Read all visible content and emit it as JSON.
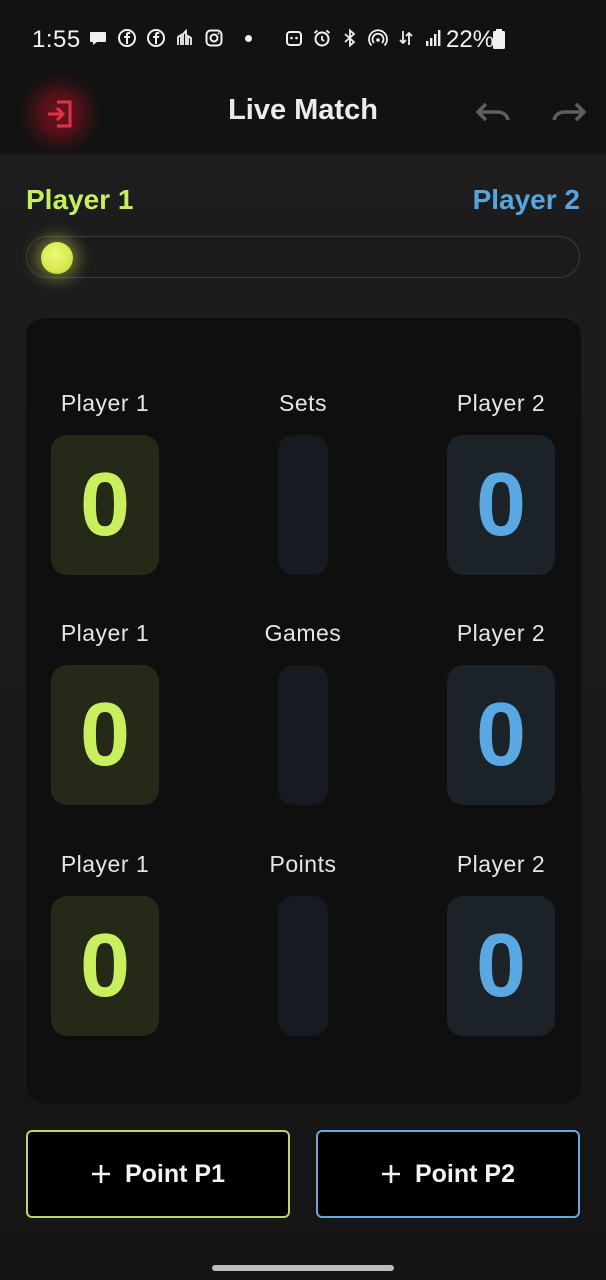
{
  "status_bar": {
    "time": "1:55",
    "battery": "22%",
    "left_icons": [
      "chat-bubble-icon",
      "facebook-icon",
      "facebook-icon",
      "chart-icon",
      "instagram-icon",
      "dot-icon"
    ],
    "right_icons": [
      "android-icon",
      "alarm-icon",
      "bluetooth-icon",
      "hotspot-icon",
      "data-arrows-icon",
      "signal-icon",
      "battery-icon"
    ]
  },
  "app_bar": {
    "title": "Live Match",
    "exit_icon": "exit-icon",
    "undo_icon": "undo-icon",
    "redo_icon": "redo-icon"
  },
  "players": {
    "p1_name": "Player 1",
    "p2_name": "Player 2"
  },
  "serve_indicator": {
    "icon": "tennis-ball-icon"
  },
  "scoreboard": {
    "rows": [
      {
        "category": "Sets",
        "p1_label": "Player 1",
        "p2_label": "Player 2",
        "p1_score": "0",
        "p2_score": "0"
      },
      {
        "category": "Games",
        "p1_label": "Player 1",
        "p2_label": "Player 2",
        "p1_score": "0",
        "p2_score": "0"
      },
      {
        "category": "Points",
        "p1_label": "Player 1",
        "p2_label": "Player 2",
        "p1_score": "0",
        "p2_score": "0"
      }
    ]
  },
  "actions": {
    "p1_button": "Point P1",
    "p2_button": "Point P2"
  },
  "colors": {
    "p1_accent": "#c9ef5f",
    "p2_accent": "#5aa8e2",
    "exit_accent": "#e0324a"
  }
}
